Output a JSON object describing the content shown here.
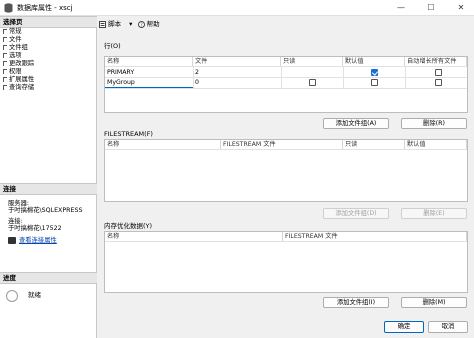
{
  "window": {
    "title": "数据库属性 - xscj",
    "minimize": "—",
    "maximize": "☐",
    "close": "✕"
  },
  "left": {
    "select_page_header": "选择页",
    "pages": [
      "常规",
      "文件",
      "文件组",
      "选项",
      "更改跟踪",
      "权限",
      "扩展属性",
      "查询存储"
    ],
    "connection_header": "连接",
    "server_label": "服务器:",
    "server_value": "于吋搞棉花\\SQLEXPRESS",
    "conn_label": "连接:",
    "conn_value": "于吋搞棉花\\17522",
    "view_conn_props": "查看连接属性",
    "progress_header": "进度",
    "progress_status": "就绪"
  },
  "toolbar": {
    "script": "脚本",
    "help": "帮助"
  },
  "rows": {
    "label": "行(O)",
    "headers": [
      "名称",
      "文件",
      "只读",
      "默认值",
      "自动增长所有文件"
    ],
    "items": [
      {
        "name": "PRIMARY",
        "files": "2",
        "readonly": false,
        "default": true,
        "autogrow": false
      },
      {
        "name": "MyGroup",
        "files": "0",
        "readonly": false,
        "default": false,
        "autogrow": false
      }
    ],
    "add_button": "添加文件组(A)",
    "remove_button": "删除(R)"
  },
  "filestream": {
    "label": "FILESTREAM(F)",
    "headers": [
      "名称",
      "FILESTREAM 文件",
      "只读",
      "默认值"
    ],
    "add_button": "添加文件组(D)",
    "remove_button": "删除(E)"
  },
  "memory": {
    "label": "内存优化数据(Y)",
    "headers": [
      "名称",
      "FILESTREAM 文件"
    ],
    "add_button": "添加文件组(I)",
    "remove_button": "删除(M)"
  },
  "footer": {
    "ok": "确定",
    "cancel": "取消"
  }
}
